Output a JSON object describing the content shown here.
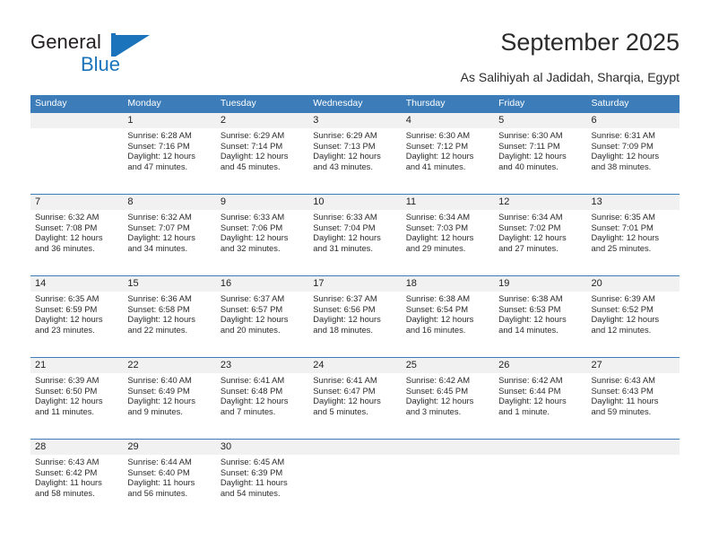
{
  "brand": {
    "word_general": "General",
    "word_blue": "Blue",
    "accent_color": "#1b74bb"
  },
  "header": {
    "title": "September 2025",
    "location": "As Salihiyah al Jadidah, Sharqia, Egypt"
  },
  "theme": {
    "header_row_bg": "#3c7cb8",
    "daynum_band_bg": "#f1f1f1",
    "row_divider": "#3c7cb8",
    "text": "#2b2b2b"
  },
  "weekday_headers": [
    "Sunday",
    "Monday",
    "Tuesday",
    "Wednesday",
    "Thursday",
    "Friday",
    "Saturday"
  ],
  "weeks": [
    [
      {
        "day": ""
      },
      {
        "day": "1",
        "sunrise": "Sunrise: 6:28 AM",
        "sunset": "Sunset: 7:16 PM",
        "daylight1": "Daylight: 12 hours",
        "daylight2": "and 47 minutes."
      },
      {
        "day": "2",
        "sunrise": "Sunrise: 6:29 AM",
        "sunset": "Sunset: 7:14 PM",
        "daylight1": "Daylight: 12 hours",
        "daylight2": "and 45 minutes."
      },
      {
        "day": "3",
        "sunrise": "Sunrise: 6:29 AM",
        "sunset": "Sunset: 7:13 PM",
        "daylight1": "Daylight: 12 hours",
        "daylight2": "and 43 minutes."
      },
      {
        "day": "4",
        "sunrise": "Sunrise: 6:30 AM",
        "sunset": "Sunset: 7:12 PM",
        "daylight1": "Daylight: 12 hours",
        "daylight2": "and 41 minutes."
      },
      {
        "day": "5",
        "sunrise": "Sunrise: 6:30 AM",
        "sunset": "Sunset: 7:11 PM",
        "daylight1": "Daylight: 12 hours",
        "daylight2": "and 40 minutes."
      },
      {
        "day": "6",
        "sunrise": "Sunrise: 6:31 AM",
        "sunset": "Sunset: 7:09 PM",
        "daylight1": "Daylight: 12 hours",
        "daylight2": "and 38 minutes."
      }
    ],
    [
      {
        "day": "7",
        "sunrise": "Sunrise: 6:32 AM",
        "sunset": "Sunset: 7:08 PM",
        "daylight1": "Daylight: 12 hours",
        "daylight2": "and 36 minutes."
      },
      {
        "day": "8",
        "sunrise": "Sunrise: 6:32 AM",
        "sunset": "Sunset: 7:07 PM",
        "daylight1": "Daylight: 12 hours",
        "daylight2": "and 34 minutes."
      },
      {
        "day": "9",
        "sunrise": "Sunrise: 6:33 AM",
        "sunset": "Sunset: 7:06 PM",
        "daylight1": "Daylight: 12 hours",
        "daylight2": "and 32 minutes."
      },
      {
        "day": "10",
        "sunrise": "Sunrise: 6:33 AM",
        "sunset": "Sunset: 7:04 PM",
        "daylight1": "Daylight: 12 hours",
        "daylight2": "and 31 minutes."
      },
      {
        "day": "11",
        "sunrise": "Sunrise: 6:34 AM",
        "sunset": "Sunset: 7:03 PM",
        "daylight1": "Daylight: 12 hours",
        "daylight2": "and 29 minutes."
      },
      {
        "day": "12",
        "sunrise": "Sunrise: 6:34 AM",
        "sunset": "Sunset: 7:02 PM",
        "daylight1": "Daylight: 12 hours",
        "daylight2": "and 27 minutes."
      },
      {
        "day": "13",
        "sunrise": "Sunrise: 6:35 AM",
        "sunset": "Sunset: 7:01 PM",
        "daylight1": "Daylight: 12 hours",
        "daylight2": "and 25 minutes."
      }
    ],
    [
      {
        "day": "14",
        "sunrise": "Sunrise: 6:35 AM",
        "sunset": "Sunset: 6:59 PM",
        "daylight1": "Daylight: 12 hours",
        "daylight2": "and 23 minutes."
      },
      {
        "day": "15",
        "sunrise": "Sunrise: 6:36 AM",
        "sunset": "Sunset: 6:58 PM",
        "daylight1": "Daylight: 12 hours",
        "daylight2": "and 22 minutes."
      },
      {
        "day": "16",
        "sunrise": "Sunrise: 6:37 AM",
        "sunset": "Sunset: 6:57 PM",
        "daylight1": "Daylight: 12 hours",
        "daylight2": "and 20 minutes."
      },
      {
        "day": "17",
        "sunrise": "Sunrise: 6:37 AM",
        "sunset": "Sunset: 6:56 PM",
        "daylight1": "Daylight: 12 hours",
        "daylight2": "and 18 minutes."
      },
      {
        "day": "18",
        "sunrise": "Sunrise: 6:38 AM",
        "sunset": "Sunset: 6:54 PM",
        "daylight1": "Daylight: 12 hours",
        "daylight2": "and 16 minutes."
      },
      {
        "day": "19",
        "sunrise": "Sunrise: 6:38 AM",
        "sunset": "Sunset: 6:53 PM",
        "daylight1": "Daylight: 12 hours",
        "daylight2": "and 14 minutes."
      },
      {
        "day": "20",
        "sunrise": "Sunrise: 6:39 AM",
        "sunset": "Sunset: 6:52 PM",
        "daylight1": "Daylight: 12 hours",
        "daylight2": "and 12 minutes."
      }
    ],
    [
      {
        "day": "21",
        "sunrise": "Sunrise: 6:39 AM",
        "sunset": "Sunset: 6:50 PM",
        "daylight1": "Daylight: 12 hours",
        "daylight2": "and 11 minutes."
      },
      {
        "day": "22",
        "sunrise": "Sunrise: 6:40 AM",
        "sunset": "Sunset: 6:49 PM",
        "daylight1": "Daylight: 12 hours",
        "daylight2": "and 9 minutes."
      },
      {
        "day": "23",
        "sunrise": "Sunrise: 6:41 AM",
        "sunset": "Sunset: 6:48 PM",
        "daylight1": "Daylight: 12 hours",
        "daylight2": "and 7 minutes."
      },
      {
        "day": "24",
        "sunrise": "Sunrise: 6:41 AM",
        "sunset": "Sunset: 6:47 PM",
        "daylight1": "Daylight: 12 hours",
        "daylight2": "and 5 minutes."
      },
      {
        "day": "25",
        "sunrise": "Sunrise: 6:42 AM",
        "sunset": "Sunset: 6:45 PM",
        "daylight1": "Daylight: 12 hours",
        "daylight2": "and 3 minutes."
      },
      {
        "day": "26",
        "sunrise": "Sunrise: 6:42 AM",
        "sunset": "Sunset: 6:44 PM",
        "daylight1": "Daylight: 12 hours",
        "daylight2": "and 1 minute."
      },
      {
        "day": "27",
        "sunrise": "Sunrise: 6:43 AM",
        "sunset": "Sunset: 6:43 PM",
        "daylight1": "Daylight: 11 hours",
        "daylight2": "and 59 minutes."
      }
    ],
    [
      {
        "day": "28",
        "sunrise": "Sunrise: 6:43 AM",
        "sunset": "Sunset: 6:42 PM",
        "daylight1": "Daylight: 11 hours",
        "daylight2": "and 58 minutes."
      },
      {
        "day": "29",
        "sunrise": "Sunrise: 6:44 AM",
        "sunset": "Sunset: 6:40 PM",
        "daylight1": "Daylight: 11 hours",
        "daylight2": "and 56 minutes."
      },
      {
        "day": "30",
        "sunrise": "Sunrise: 6:45 AM",
        "sunset": "Sunset: 6:39 PM",
        "daylight1": "Daylight: 11 hours",
        "daylight2": "and 54 minutes."
      },
      {
        "day": ""
      },
      {
        "day": ""
      },
      {
        "day": ""
      },
      {
        "day": ""
      }
    ]
  ]
}
